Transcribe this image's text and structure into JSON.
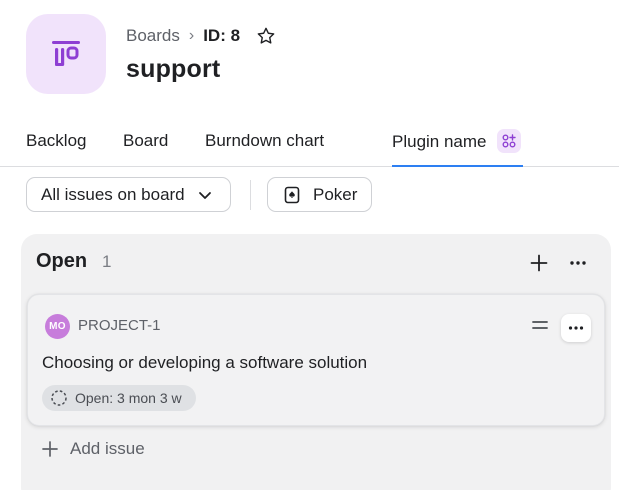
{
  "header": {
    "breadcrumb_root": "Boards",
    "breadcrumb_separator": "›",
    "board_id": "ID: 8",
    "title": "support",
    "logo_icon": "board-logo-icon",
    "star_icon": "star-icon"
  },
  "tabs": [
    {
      "label": "Backlog",
      "active": false
    },
    {
      "label": "Board",
      "active": false
    },
    {
      "label": "Burndown chart",
      "active": false
    },
    {
      "label": "Plugin name",
      "active": true,
      "icon": "plugin-icon"
    }
  ],
  "toolbar": {
    "filter_label": "All issues on board",
    "filter_icon": "chevron-down-icon",
    "poker_label": "Poker",
    "poker_icon": "poker-card-icon"
  },
  "column": {
    "title": "Open",
    "count": "1",
    "add_icon": "plus-icon",
    "more_icon": "more-horizontal-icon",
    "add_issue_label": "Add issue"
  },
  "card": {
    "avatar_initials": "MO",
    "issue_key": "PROJECT-1",
    "summary": "Choosing or developing a software solution",
    "status": "Open: 3 mon 3 w",
    "priority_icon": "priority-medium-icon",
    "status_icon": "status-open-icon"
  },
  "colors": {
    "accent": "#2d7ff2",
    "brand_purple": "#8e3fd3",
    "logo_bg": "#f1e3fb",
    "avatar_bg": "#c77ddb",
    "column_bg": "#f1f1f2"
  }
}
